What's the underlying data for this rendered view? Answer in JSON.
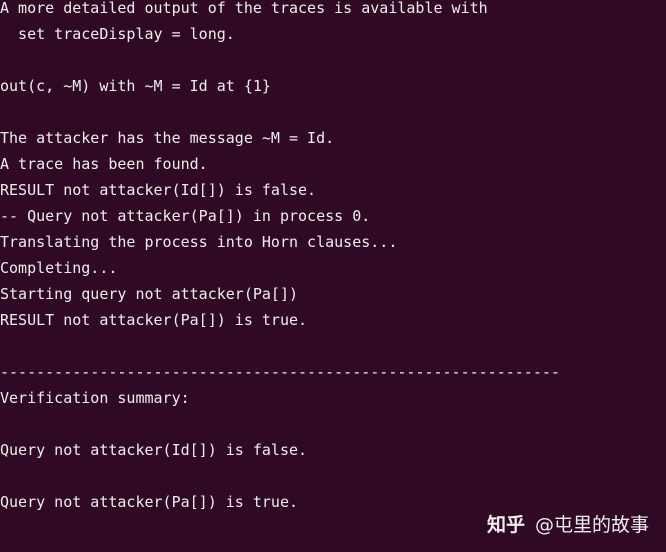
{
  "colors": {
    "background": "#300a24",
    "text": "#eeeeec"
  },
  "terminal": {
    "lines": [
      "A more detailed output of the traces is available with",
      "  set traceDisplay = long.",
      "",
      "out(c, ~M) with ~M = Id at {1}",
      "",
      "The attacker has the message ~M = Id.",
      "A trace has been found.",
      "RESULT not attacker(Id[]) is false.",
      "-- Query not attacker(Pa[]) in process 0.",
      "Translating the process into Horn clauses...",
      "Completing...",
      "Starting query not attacker(Pa[])",
      "RESULT not attacker(Pa[]) is true.",
      "",
      "--------------------------------------------------------------",
      "Verification summary:",
      "",
      "Query not attacker(Id[]) is false.",
      "",
      "Query not attacker(Pa[]) is true."
    ]
  },
  "watermark": {
    "logo": "知乎",
    "author": "@屯里的故事"
  }
}
